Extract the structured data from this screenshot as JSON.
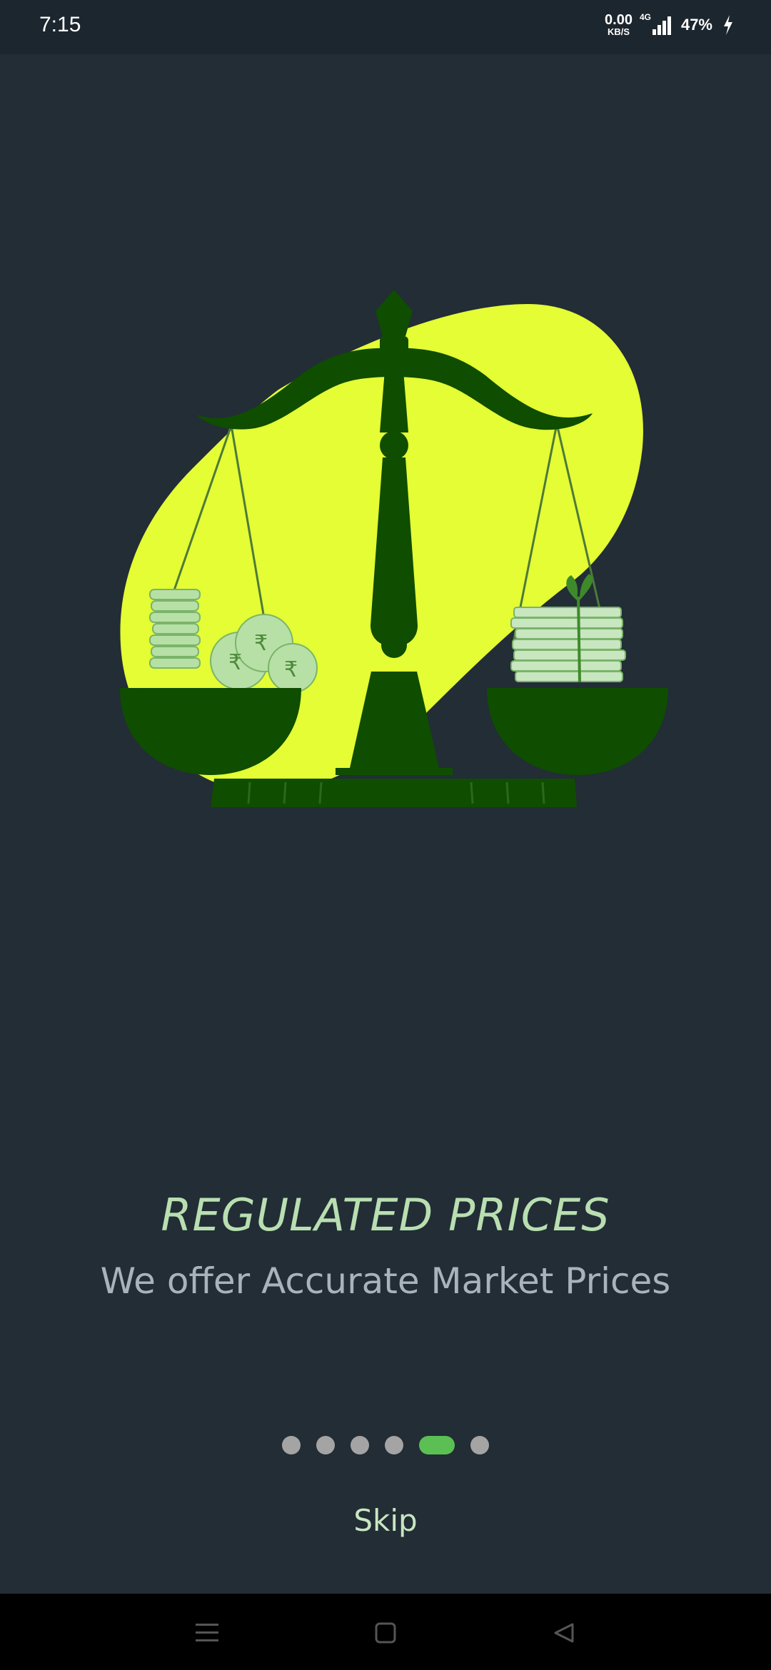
{
  "status_bar": {
    "time": "7:15",
    "net_speed_value": "0.00",
    "net_speed_unit": "KB/S",
    "network_type": "4G",
    "battery": "47%"
  },
  "onboarding": {
    "title": "REGULATED PRICES",
    "subtitle": "We offer Accurate Market Prices",
    "page_count": 6,
    "active_page_index": 4,
    "skip_label": "Skip"
  },
  "icons": {
    "illustration": "balance-scale-illustration",
    "nav_menu": "menu-icon",
    "nav_home": "square-home-icon",
    "nav_back": "triangle-back-icon"
  },
  "colors": {
    "background": "#222d36",
    "title": "#b9dfb1",
    "subtitle": "#a9b3ba",
    "dot_inactive": "#a4a4a4",
    "dot_active": "#5bbf53",
    "scale_dark": "#0f4d00",
    "blob_yellow": "#e4fd34"
  }
}
